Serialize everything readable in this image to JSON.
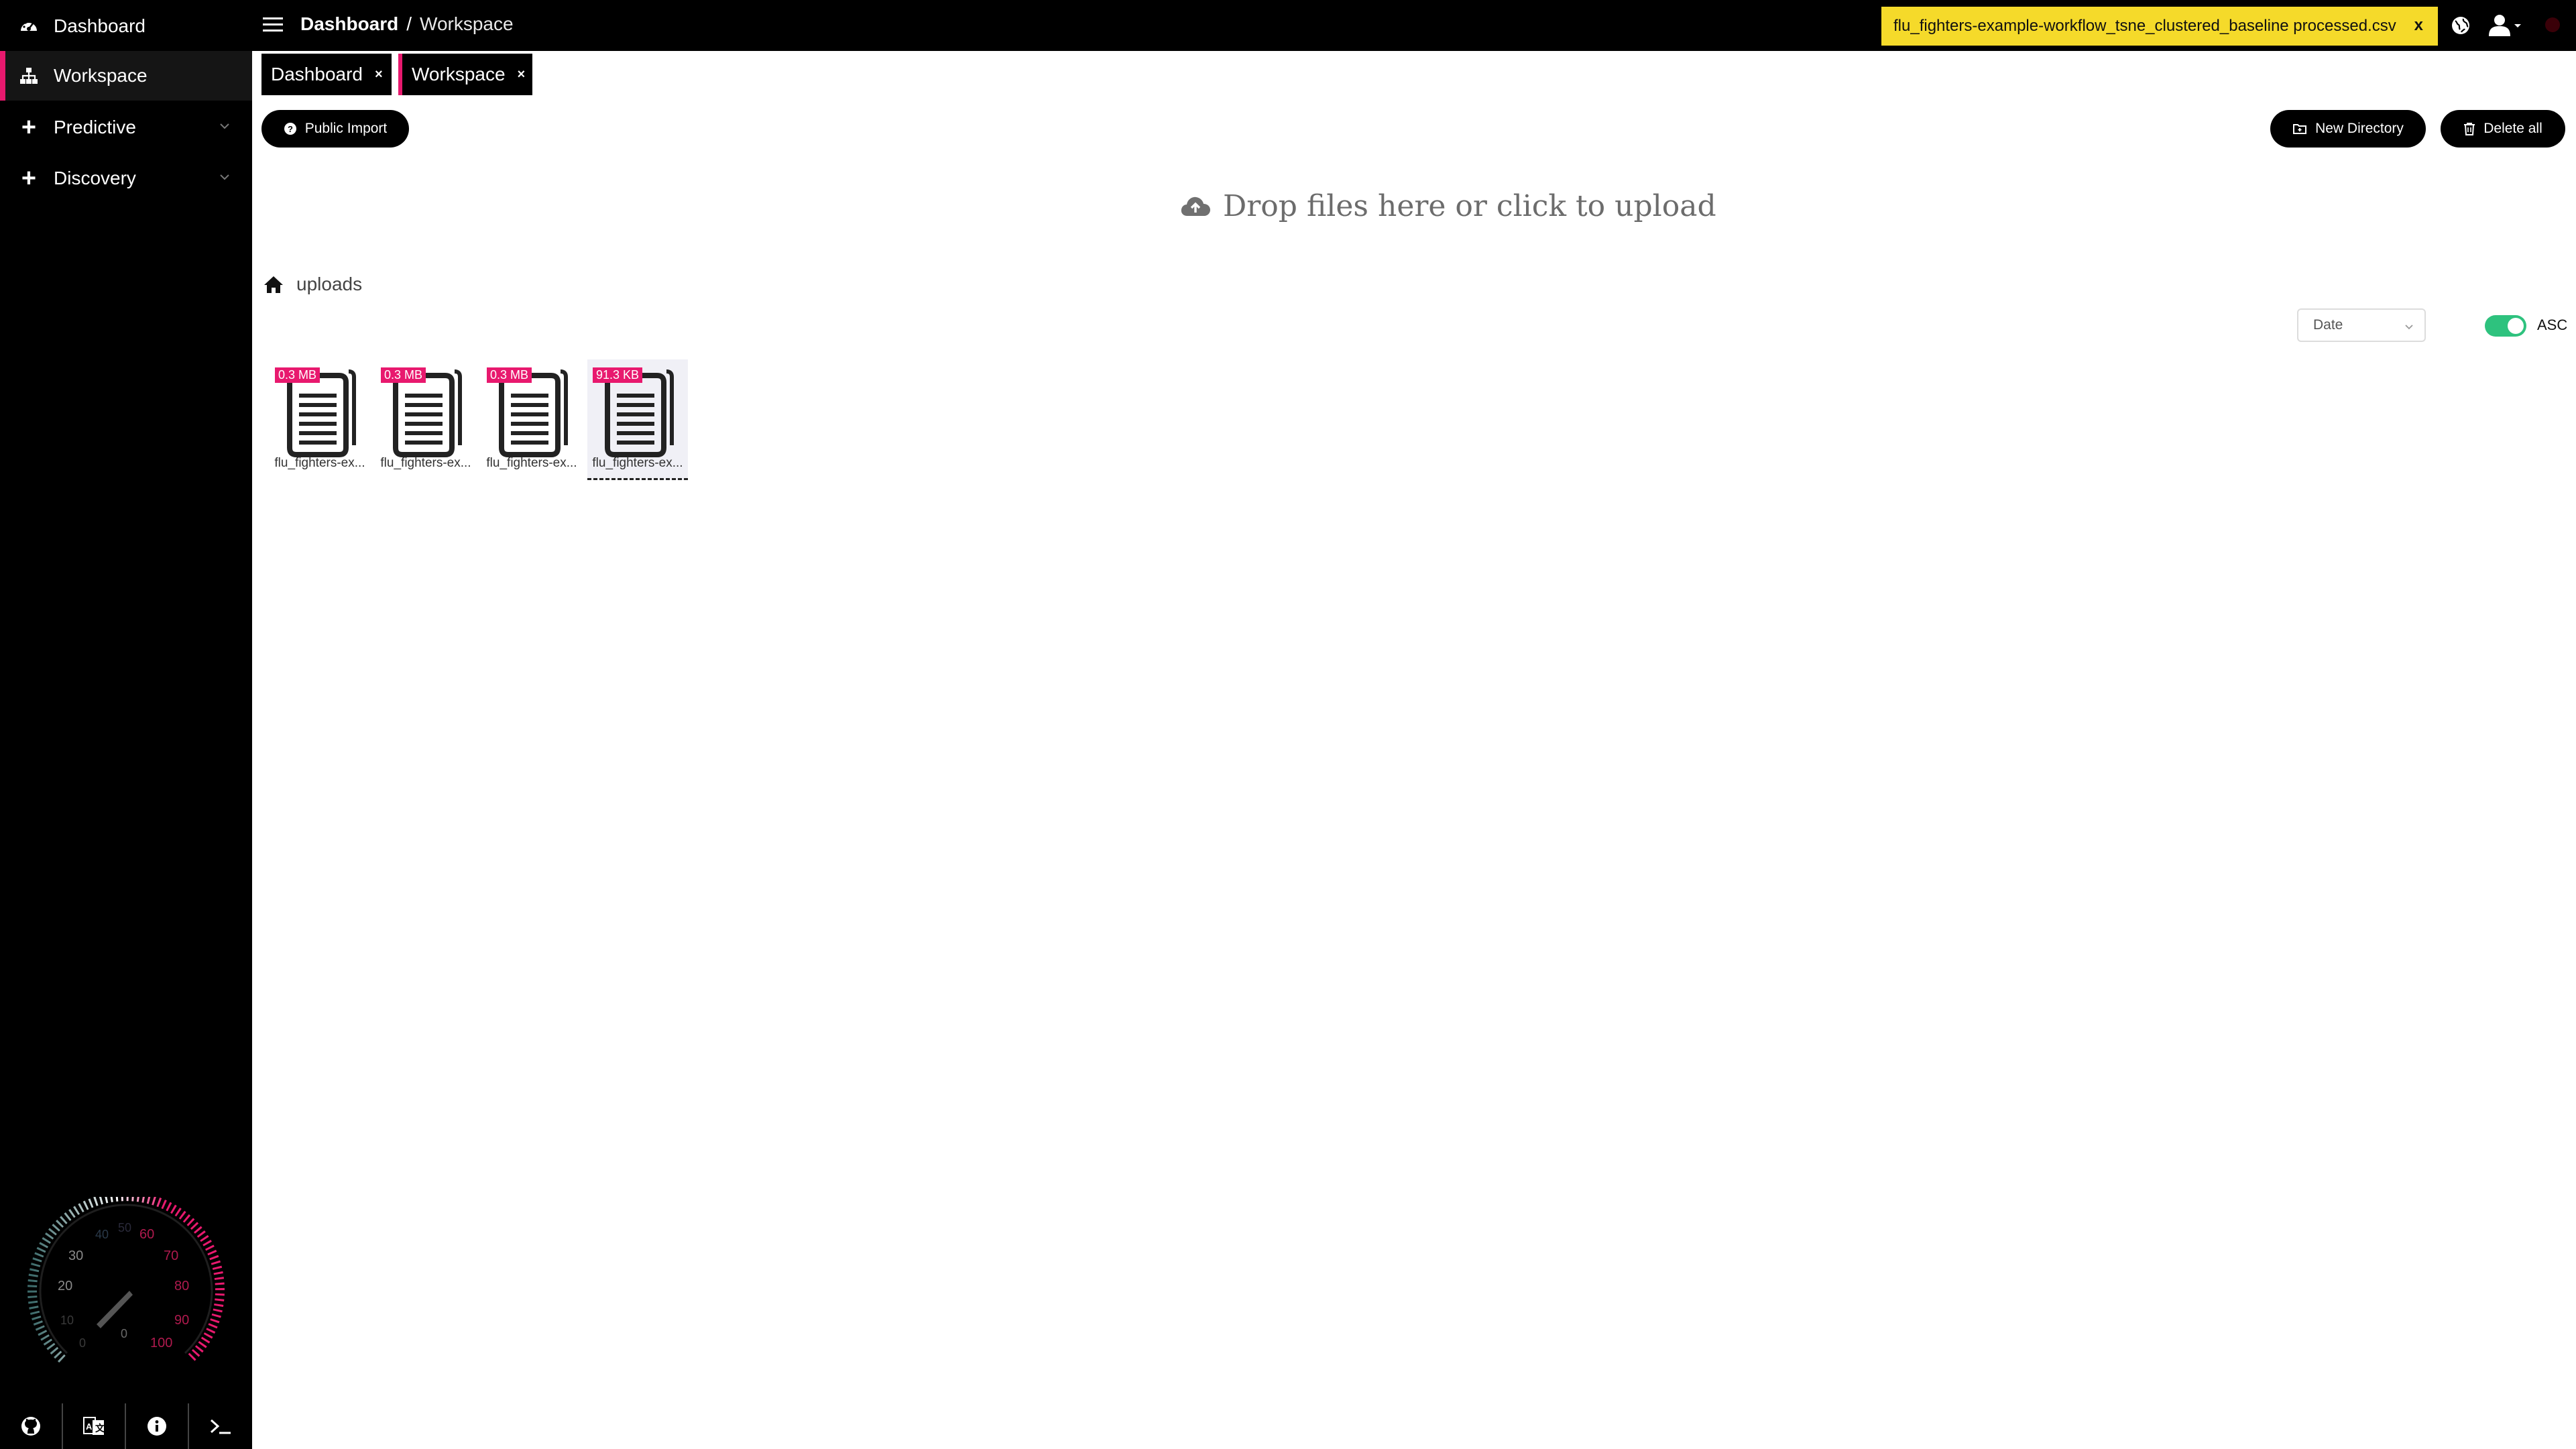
{
  "sidebar": {
    "items": [
      {
        "label": "Dashboard",
        "icon": "dashboard-icon"
      },
      {
        "label": "Workspace",
        "icon": "sitemap-icon",
        "active": true
      },
      {
        "label": "Predictive",
        "icon": "plus-icon"
      },
      {
        "label": "Discovery",
        "icon": "plus-icon"
      }
    ],
    "gauge": {
      "ticks": [
        "0",
        "10",
        "20",
        "30",
        "40",
        "50",
        "60",
        "70",
        "80",
        "90",
        "100"
      ],
      "center_value": "0",
      "accent_color": "#e8196e"
    },
    "bottom_buttons": [
      {
        "icon": "github-icon"
      },
      {
        "icon": "language-icon"
      },
      {
        "icon": "info-icon"
      },
      {
        "icon": "terminal-icon"
      }
    ]
  },
  "topbar": {
    "breadcrumb_root": "Dashboard",
    "breadcrumb_separator": "/",
    "breadcrumb_current": "Workspace",
    "notification_text": "flu_fighters-example-workflow_tsne_clustered_baseline processed.csv",
    "notification_close": "x",
    "notification_color": "#f5da2a"
  },
  "tabs": [
    {
      "label": "Dashboard",
      "close": "×"
    },
    {
      "label": "Workspace",
      "close": "×",
      "active": true
    }
  ],
  "toolbar": {
    "public_import": "Public Import",
    "new_directory": "New Directory",
    "delete_all": "Delete all"
  },
  "dropzone": {
    "text": "Drop files here or click to upload"
  },
  "path": {
    "label": "uploads"
  },
  "sort": {
    "field": "Date",
    "order_label": "ASC",
    "ascending": true,
    "toggle_color": "#2ec27e"
  },
  "files": [
    {
      "size": "0.3 MB",
      "name": "flu_fighters-ex..."
    },
    {
      "size": "0.3 MB",
      "name": "flu_fighters-ex..."
    },
    {
      "size": "0.3 MB",
      "name": "flu_fighters-ex..."
    },
    {
      "size": "91.3 KB",
      "name": "flu_fighters-ex...",
      "selected": true
    }
  ]
}
